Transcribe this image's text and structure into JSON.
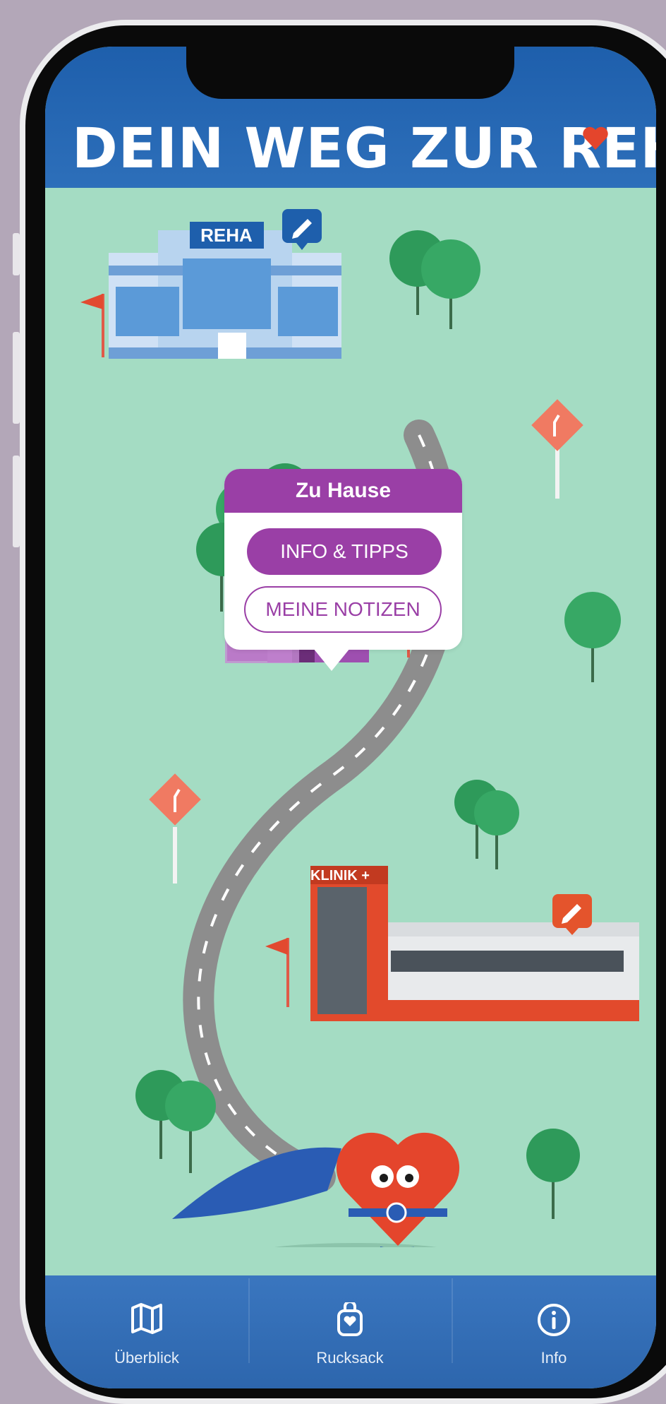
{
  "header": {
    "title": "DEIN WEG ZUR REHA"
  },
  "map": {
    "building_labels": {
      "reha": "REHA",
      "klinik": "KLINIK +"
    }
  },
  "popup": {
    "title": "Zu Hause",
    "info_button": "INFO & TIPPS",
    "notes_button": "MEINE NOTIZEN"
  },
  "tabbar": {
    "items": [
      {
        "label": "Überblick",
        "icon": "map-icon"
      },
      {
        "label": "Rucksack",
        "icon": "backpack-icon"
      },
      {
        "label": "Info",
        "icon": "info-icon"
      }
    ]
  },
  "colors": {
    "header_blue": "#1e5fac",
    "map_green": "#a4dcc3",
    "popup_purple": "#9a3fa6",
    "edit_badge_blue": "#1e5fac",
    "edit_badge_red": "#e4542c",
    "heart_red": "#e4452c"
  }
}
